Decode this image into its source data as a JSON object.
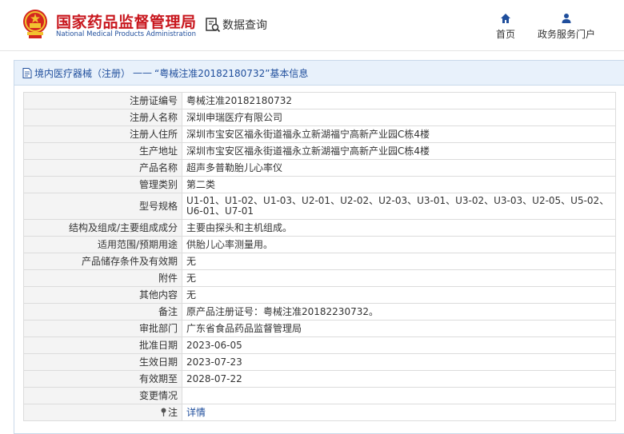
{
  "header": {
    "site_title": "国家药品监督管理局",
    "site_subtitle": "National Medical Products Administration",
    "search_label": "数据查询",
    "nav": {
      "home_label": "首页",
      "portal_label": "政务服务门户"
    }
  },
  "breadcrumb": {
    "category": "境内医疗器械（注册）",
    "separator": "——",
    "current": "“粤械注准20182180732”基本信息"
  },
  "rows": [
    {
      "label": "注册证编号",
      "value": "粤械注准20182180732"
    },
    {
      "label": "注册人名称",
      "value": "深圳申瑞医疗有限公司"
    },
    {
      "label": "注册人住所",
      "value": "深圳市宝安区福永街道福永立新湖福宁高新产业园C栋4楼"
    },
    {
      "label": "生产地址",
      "value": "深圳市宝安区福永街道福永立新湖福宁高新产业园C栋4楼"
    },
    {
      "label": "产品名称",
      "value": "超声多普勒胎儿心率仪"
    },
    {
      "label": "管理类别",
      "value": "第二类"
    },
    {
      "label": "型号规格",
      "value": "U1-01、U1-02、U1-03、U2-01、U2-02、U2-03、U3-01、U3-02、U3-03、U2-05、U5-02、U6-01、U7-01"
    },
    {
      "label": "结构及组成/主要组成成分",
      "value": "主要由探头和主机组成。"
    },
    {
      "label": "适用范围/预期用途",
      "value": "供胎儿心率测量用。"
    },
    {
      "label": "产品储存条件及有效期",
      "value": "无"
    },
    {
      "label": "附件",
      "value": "无"
    },
    {
      "label": "其他内容",
      "value": "无"
    },
    {
      "label": "备注",
      "value": "原产品注册证号：粤械注准20182230732。"
    },
    {
      "label": "审批部门",
      "value": "广东省食品药品监督管理局"
    },
    {
      "label": "批准日期",
      "value": "2023-06-05"
    },
    {
      "label": "生效日期",
      "value": "2023-07-23"
    },
    {
      "label": "有效期至",
      "value": "2028-07-22"
    },
    {
      "label": "变更情况",
      "value": ""
    }
  ],
  "note_row": {
    "label": "注",
    "link_text": "详情",
    "icon": "pin-icon"
  },
  "colors": {
    "brand_red": "#c8161d",
    "brand_blue": "#1f4e9c",
    "panel_head_bg": "#e8f1fb",
    "label_bg": "#f4f4f4"
  }
}
